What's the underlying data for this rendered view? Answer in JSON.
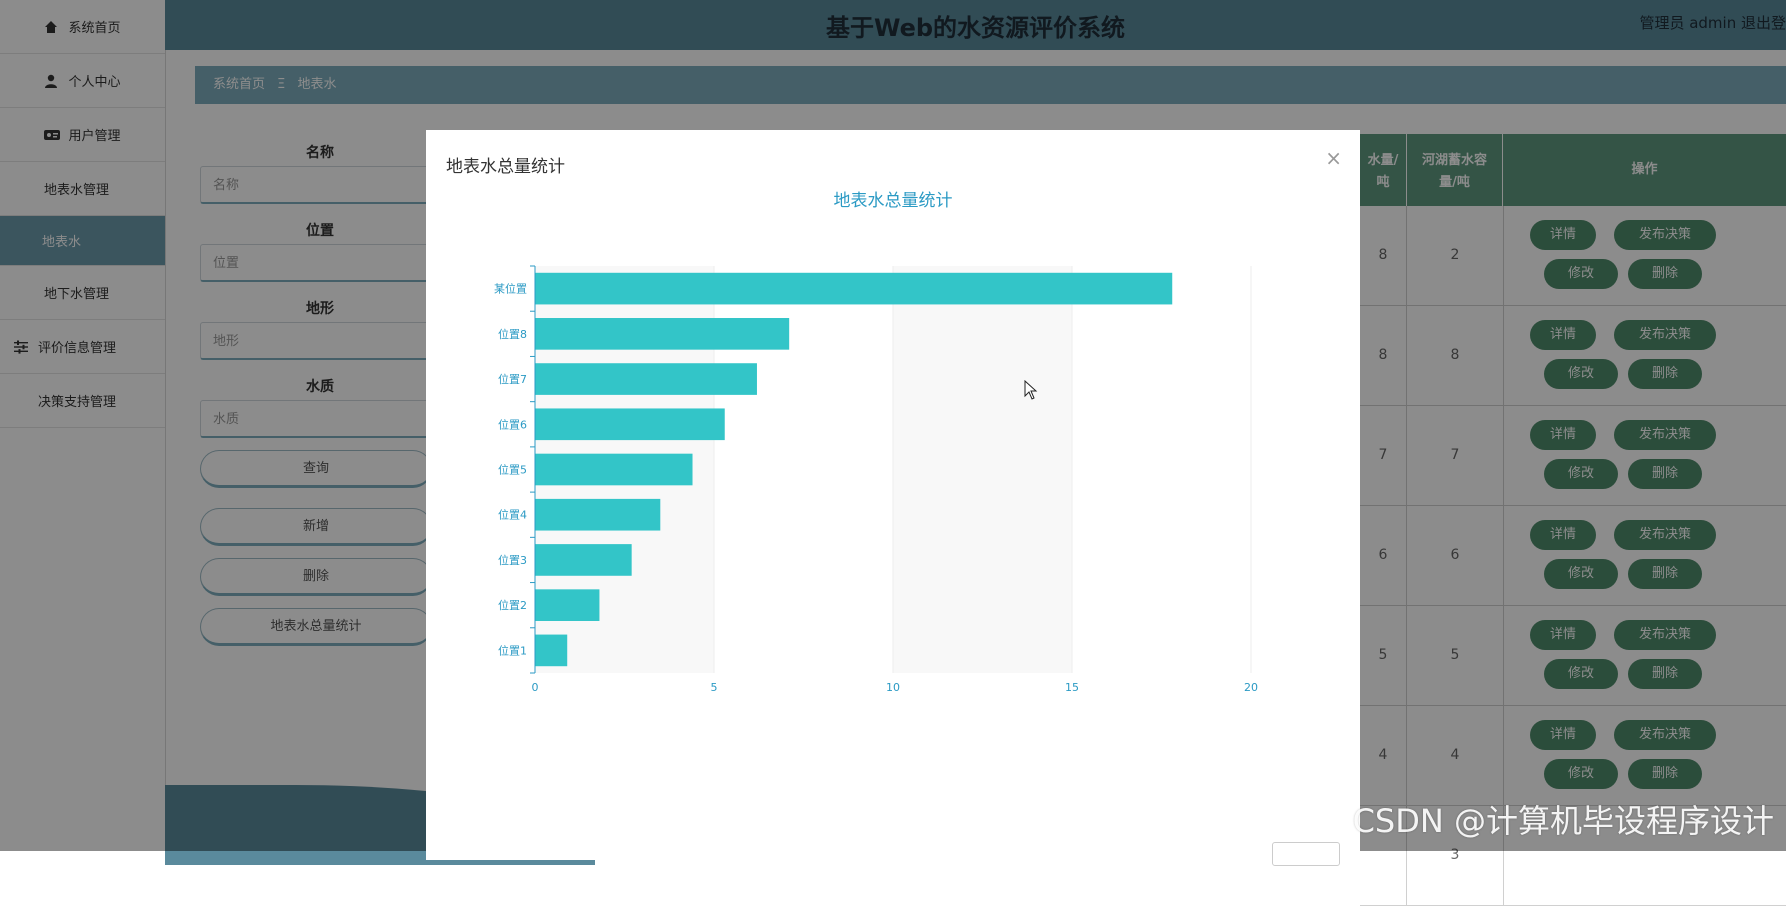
{
  "app": {
    "title": "基于Web的水资源评价系统",
    "user": "管理员 admin  退出登"
  },
  "sidebar": {
    "items": [
      {
        "label": "系统首页",
        "icon": "home-icon"
      },
      {
        "label": "个人中心",
        "icon": "person-icon"
      },
      {
        "label": "用户管理",
        "icon": "users-icon"
      },
      {
        "label": "地表水管理",
        "icon": "grid-icon"
      },
      {
        "label": "地表水",
        "icon": ""
      },
      {
        "label": "地下水管理",
        "icon": "grid-icon"
      },
      {
        "label": "评价信息管理",
        "icon": "sliders-icon"
      },
      {
        "label": "决策支持管理",
        "icon": "grid-icon"
      }
    ]
  },
  "breadcrumb": {
    "home": "系统首页",
    "separator": "Ξ",
    "current": "地表水"
  },
  "form": {
    "fields": [
      {
        "label": "名称",
        "placeholder": "名称"
      },
      {
        "label": "位置",
        "placeholder": "位置"
      },
      {
        "label": "地形",
        "placeholder": "地形"
      },
      {
        "label": "水质",
        "placeholder": "水质"
      }
    ],
    "buttons": {
      "query": "查询",
      "add": "新增",
      "delete": "删除",
      "stats": "地表水总量统计"
    }
  },
  "table": {
    "headers": {
      "col1": "水量/\n吨",
      "col2": "河湖蓄水容\n量/吨",
      "ops": "操作"
    },
    "rows": [
      {
        "c1": "8",
        "c2": "2"
      },
      {
        "c1": "8",
        "c2": "8"
      },
      {
        "c1": "7",
        "c2": "7"
      },
      {
        "c1": "6",
        "c2": "6"
      },
      {
        "c1": "5",
        "c2": "5"
      },
      {
        "c1": "4",
        "c2": "4"
      }
    ],
    "row_buttons": {
      "detail": "详情",
      "publish": "发布决策",
      "edit": "修改",
      "delete": "删除"
    },
    "partial_row_value": "3"
  },
  "modal": {
    "title": "地表水总量统计",
    "close": "×"
  },
  "chart_data": {
    "type": "bar",
    "orientation": "horizontal",
    "title": "地表水总量统计",
    "categories": [
      "某位置",
      "位置8",
      "位置7",
      "位置6",
      "位置5",
      "位置4",
      "位置3",
      "位置2",
      "位置1"
    ],
    "values": [
      17.8,
      7.1,
      6.2,
      5.3,
      4.4,
      3.5,
      2.7,
      1.8,
      0.9
    ],
    "xlim": [
      0,
      20
    ],
    "xticks": [
      0,
      5,
      10,
      15,
      20
    ],
    "grid": "vertical bands",
    "colors": {
      "bar": "#33c5c8",
      "axis": "#2b9ac4",
      "title": "#2b9ac4",
      "band": "#f8f8f8"
    }
  },
  "watermark": "CSDN @计算机毕设程序设计"
}
